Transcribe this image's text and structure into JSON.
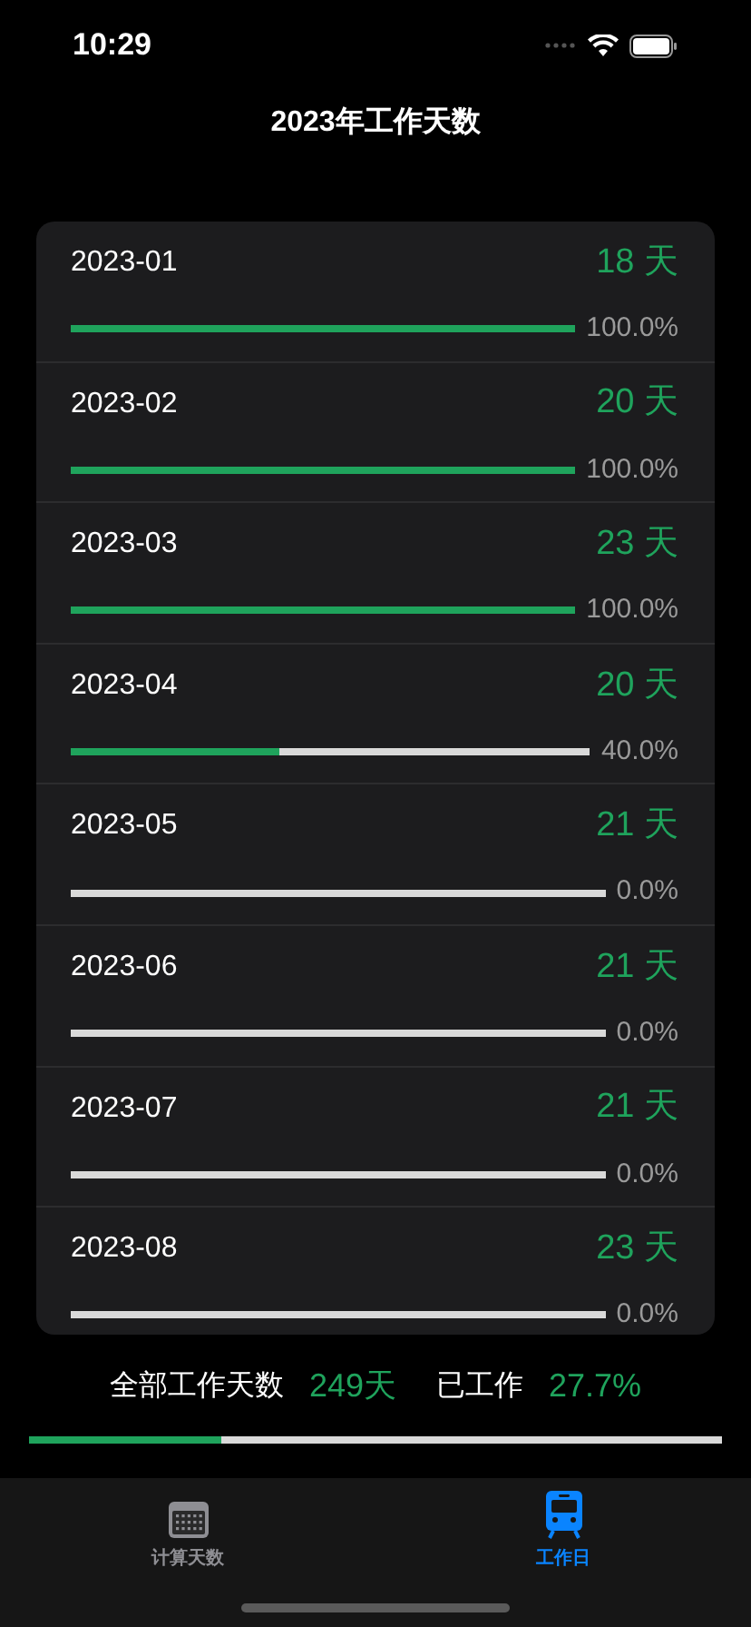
{
  "status_bar": {
    "time": "10:29"
  },
  "title": "2023年工作天数",
  "months": [
    {
      "name": "2023-01",
      "days": "18 天",
      "level": 1,
      "percent": "100.0%"
    },
    {
      "name": "2023-02",
      "days": "20 天",
      "level": 1,
      "percent": "100.0%"
    },
    {
      "name": "2023-03",
      "days": "23 天",
      "level": 1,
      "percent": "100.0%"
    },
    {
      "name": "2023-04",
      "days": "20 天",
      "level": 0.4,
      "percent": "40.0%"
    },
    {
      "name": "2023-05",
      "days": "21 天",
      "level": 0,
      "percent": "0.0%"
    },
    {
      "name": "2023-06",
      "days": "21 天",
      "level": 0,
      "percent": "0.0%"
    },
    {
      "name": "2023-07",
      "days": "21 天",
      "level": 0,
      "percent": "0.0%"
    },
    {
      "name": "2023-08",
      "days": "23 天",
      "level": 0,
      "percent": "0.0%"
    }
  ],
  "summary": {
    "total_label": "全部工作天数",
    "total_value": "249天",
    "worked_label": "已工作",
    "worked_value": "27.7%",
    "level": 0.277
  },
  "tabs": [
    {
      "label": "计算天数",
      "kind": "calendar",
      "selected": false
    },
    {
      "label": "工作日",
      "kind": "train",
      "selected": true
    }
  ]
}
